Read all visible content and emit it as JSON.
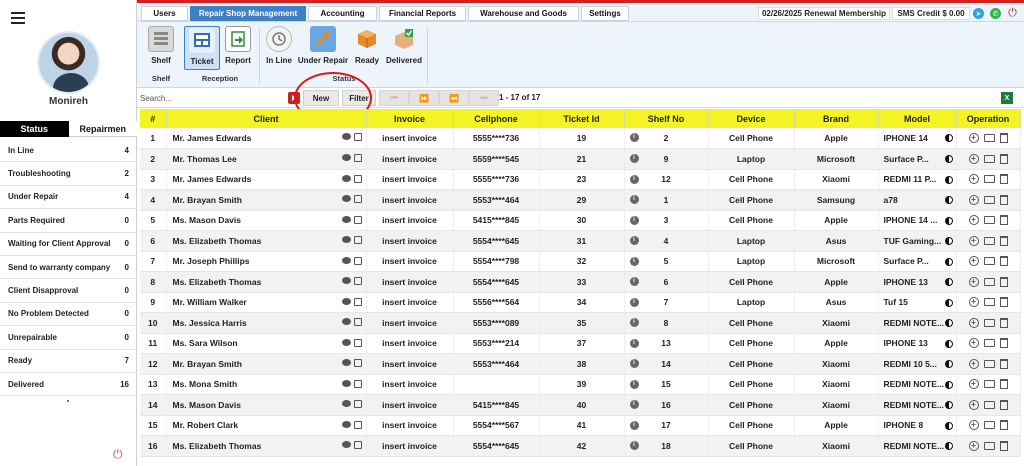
{
  "user": {
    "name": "Monireh"
  },
  "sidebar": {
    "tabs": [
      {
        "label": "Status"
      },
      {
        "label": "Repairmen"
      }
    ],
    "status_items": [
      {
        "label": "In Line",
        "count": "4"
      },
      {
        "label": "Troubleshooting",
        "count": "2"
      },
      {
        "label": "Under Repair",
        "count": "4"
      },
      {
        "label": "Parts Required",
        "count": "0"
      },
      {
        "label": "Waiting for Client Approval",
        "count": "0"
      },
      {
        "label": "Send to warranty company",
        "count": "0"
      },
      {
        "label": "Client Disapproval",
        "count": "0"
      },
      {
        "label": "No Problem Detected",
        "count": "0"
      },
      {
        "label": "Unrepairable",
        "count": "0"
      },
      {
        "label": "Ready",
        "count": "7"
      },
      {
        "label": "Delivered",
        "count": "16"
      }
    ]
  },
  "topnav": {
    "tabs": [
      {
        "label": "Users"
      },
      {
        "label": "Repair Shop Management"
      },
      {
        "label": "Accounting"
      },
      {
        "label": "Financial Reports"
      },
      {
        "label": "Warehouse and Goods"
      },
      {
        "label": "Settings"
      }
    ],
    "renewal": "02/26/2025 Renewal Membership",
    "sms_credit": "SMS Credit $ 0.00"
  },
  "toolbar": {
    "tools": [
      {
        "label": "Shelf",
        "icon": "shelf-icon"
      },
      {
        "label": "Ticket",
        "icon": "ticket-icon"
      },
      {
        "label": "Report",
        "icon": "report-icon"
      },
      {
        "label": "In Line",
        "icon": "in-line-icon"
      },
      {
        "label": "Under Repair",
        "icon": "under-repair-icon"
      },
      {
        "label": "Ready",
        "icon": "ready-icon"
      },
      {
        "label": "Delivered",
        "icon": "delivered-icon"
      }
    ],
    "groups": [
      {
        "label": "Shelf"
      },
      {
        "label": "Reception"
      },
      {
        "label": "Status"
      }
    ]
  },
  "search": {
    "placeholder": "Search...",
    "new_label": "New",
    "filter_label": "Filter",
    "range": "1 - 17 of 17",
    "excel_label": "X"
  },
  "table": {
    "columns": [
      "#",
      "Client",
      "Invoice",
      "Cellphone",
      "Ticket Id",
      "Shelf No",
      "Device",
      "Brand",
      "Model",
      "Operation"
    ],
    "rows": [
      [
        "1",
        "Mr. James Edwards",
        "insert invoice",
        "5555****736",
        "19",
        "2",
        "Cell Phone",
        "Apple",
        "IPHONE 14"
      ],
      [
        "2",
        "Mr. Thomas Lee",
        "insert invoice",
        "5559****545",
        "21",
        "9",
        "Laptop",
        "Microsoft",
        "Surface P..."
      ],
      [
        "3",
        "Mr. James Edwards",
        "insert invoice",
        "5555****736",
        "23",
        "12",
        "Cell Phone",
        "Xiaomi",
        "REDMI 11 P..."
      ],
      [
        "4",
        "Mr. Brayan Smith",
        "insert invoice",
        "5553****464",
        "29",
        "1",
        "Cell Phone",
        "Samsung",
        "a78"
      ],
      [
        "5",
        "Ms. Mason Davis",
        "insert invoice",
        "5415****845",
        "30",
        "3",
        "Cell Phone",
        "Apple",
        "IPHONE 14 ..."
      ],
      [
        "6",
        "Ms. Elizabeth Thomas",
        "insert invoice",
        "5554****645",
        "31",
        "4",
        "Laptop",
        "Asus",
        "TUF Gaming..."
      ],
      [
        "7",
        "Mr. Joseph Phillips",
        "insert invoice",
        "5554****798",
        "32",
        "5",
        "Laptop",
        "Microsoft",
        "Surface P..."
      ],
      [
        "8",
        "Ms. Elizabeth Thomas",
        "insert invoice",
        "5554****645",
        "33",
        "6",
        "Cell Phone",
        "Apple",
        "IPHONE 13"
      ],
      [
        "9",
        "Mr. William Walker",
        "insert invoice",
        "5556****564",
        "34",
        "7",
        "Laptop",
        "Asus",
        "Tuf 15"
      ],
      [
        "10",
        "Ms. Jessica Harris",
        "insert invoice",
        "5553****089",
        "35",
        "8",
        "Cell Phone",
        "Xiaomi",
        "REDMI NOTE..."
      ],
      [
        "11",
        "Ms. Sara Wilson",
        "insert invoice",
        "5553****214",
        "37",
        "13",
        "Cell Phone",
        "Apple",
        "IPHONE 13"
      ],
      [
        "12",
        "Mr. Brayan Smith",
        "insert invoice",
        "5553****464",
        "38",
        "14",
        "Cell Phone",
        "Xiaomi",
        "REDMI 10 5..."
      ],
      [
        "13",
        "Ms. Mona Smith",
        "insert invoice",
        "",
        "39",
        "15",
        "Cell Phone",
        "Xiaomi",
        "REDMI NOTE..."
      ],
      [
        "14",
        "Ms. Mason Davis",
        "insert invoice",
        "5415****845",
        "40",
        "16",
        "Cell Phone",
        "Xiaomi",
        "REDMI NOTE..."
      ],
      [
        "15",
        "Mr. Robert Clark",
        "insert invoice",
        "5554****567",
        "41",
        "17",
        "Cell Phone",
        "Apple",
        "IPHONE 8"
      ],
      [
        "16",
        "Ms. Elizabeth Thomas",
        "insert invoice",
        "5554****645",
        "42",
        "18",
        "Cell Phone",
        "Xiaomi",
        "REDMI NOTE..."
      ]
    ]
  },
  "colors": {
    "accent": "#3f7fc4",
    "header_yellow": "#f4f425",
    "brand_red": "#d61f1f"
  }
}
